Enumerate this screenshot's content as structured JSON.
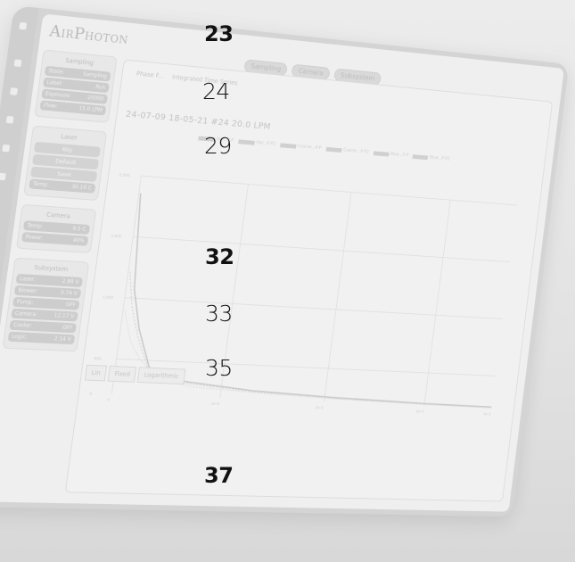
{
  "brand": {
    "name_a": "A",
    "name_b": "IR",
    "name_c": "P",
    "name_d": "HOTON"
  },
  "header_tabs": [
    "Sampling",
    "Camera",
    "Subsystem"
  ],
  "sidebar": {
    "sampling": {
      "title": "Sampling",
      "rows": [
        {
          "k": "State:",
          "v": "Sampling"
        },
        {
          "k": "Label:",
          "v": "Run"
        },
        {
          "k": "Exposure:",
          "v": "20000"
        },
        {
          "k": "Flow:",
          "v": "15.0 LPM"
        }
      ]
    },
    "laser": {
      "title": "Laser",
      "buttons": [
        "Key",
        "Default",
        "Save"
      ],
      "temp": {
        "k": "Temp:",
        "v": "30.10 C"
      }
    },
    "camera": {
      "title": "Camera",
      "rows": [
        {
          "k": "Temp:",
          "v": "9.5 C"
        },
        {
          "k": "Power:",
          "v": "40%"
        }
      ]
    },
    "subsystem": {
      "title": "Subsystem",
      "rows": [
        {
          "k": "Laser:",
          "v": "2.88 V"
        },
        {
          "k": "Blower:",
          "v": "0.74 V"
        },
        {
          "k": "Pump:",
          "v": "OFF"
        },
        {
          "k": "Camera:",
          "v": "12.17 V"
        },
        {
          "k": "Cooler:",
          "v": "OFF"
        },
        {
          "k": "Logic:",
          "v": "2.14 V"
        }
      ]
    }
  },
  "main": {
    "crumbs": [
      "Phase F...",
      "Integrated Time Series"
    ],
    "run_title": "24-07-09 18-05-21 #24 20.0 LPM",
    "legend": [
      "Har...P-P",
      "Har...P-P2",
      "Coarse...P-P",
      "Coarse...P-P2",
      "Blue...P-P",
      "Blue...P-P2"
    ],
    "y_ticks": [
      "2,000",
      "1,500",
      "1,000",
      "500",
      "0"
    ],
    "x_ticks": [
      "0",
      "1e-6",
      "1e-5",
      "1e-4",
      "1e-3"
    ],
    "bottom_buttons": [
      "Lin",
      "Fixed",
      "Logarithmic"
    ]
  },
  "overlay_numbers": {
    "n1": "23",
    "n2": "24",
    "n3": "29",
    "n4": "32",
    "n5": "33",
    "n6": "35",
    "n7": "37"
  },
  "colors": {
    "screen": "#efefef",
    "panel": "#e8e8e8",
    "pill": "#cdcdcd",
    "overlay_text": "#111111"
  }
}
